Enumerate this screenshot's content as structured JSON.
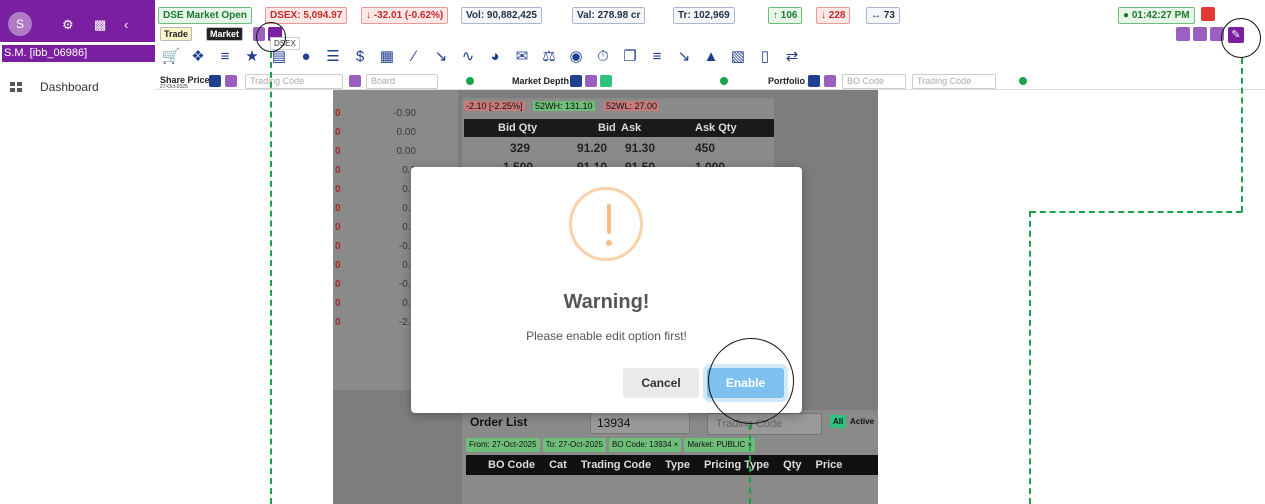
{
  "sidebar": {
    "avatar_letter": "S",
    "user": "S.M. [ibb_06986]",
    "dashboard": "Dashboard"
  },
  "header": {
    "market_status": "DSE Market Open",
    "dsex": "DSEX: 5,094.97",
    "dsex_change": "↓ -32.01 (-0.62%)",
    "vol": "Vol: 90,882,425",
    "val": "Val: 278.98 cr",
    "trades": "Tr: 102,969",
    "up": "↑ 106",
    "down": "↓ 228",
    "unch": "↔ 73",
    "time": "● 01:42:27 PM",
    "trade_btn": "Trade",
    "market_btn": "Market",
    "tooltip": "DSEX"
  },
  "filters": {
    "share_price": "Share Price",
    "date": "27-Oct-2025",
    "trading_code": "Trading Code",
    "board": "Board",
    "market_depth": "Market Depth",
    "portfolio": "Portfolio",
    "bo_code": "BO Code",
    "trading_code2": "Trading Code"
  },
  "list": [
    {
      "a": "0",
      "b": "-0.90"
    },
    {
      "a": "0",
      "b": "0.00"
    },
    {
      "a": "0",
      "b": "0.00"
    },
    {
      "a": "0",
      "b": "0.1"
    },
    {
      "a": "0",
      "b": "0.0"
    },
    {
      "a": "0",
      "b": "0.0"
    },
    {
      "a": "0",
      "b": "0.0"
    },
    {
      "a": "0",
      "b": "-0.4"
    },
    {
      "a": "0",
      "b": "0.0"
    },
    {
      "a": "0",
      "b": "-0.4"
    },
    {
      "a": "0",
      "b": "0.0"
    },
    {
      "a": "0",
      "b": "-2.1"
    }
  ],
  "depth": {
    "change": "-2.10 [-2.25%]",
    "wh": "52WH: 131.10",
    "wl": "52WL: 27.00",
    "head": [
      "Bid Qty",
      "Bid",
      "Ask",
      "Ask Qty"
    ],
    "rows": [
      [
        "329",
        "91.20",
        "91.30",
        "450"
      ],
      [
        "1,500",
        "91.10",
        "91.50",
        "1,000"
      ]
    ]
  },
  "modal": {
    "title": "Warning!",
    "message": "Please enable edit option first!",
    "cancel": "Cancel",
    "enable": "Enable"
  },
  "order": {
    "title": "Order List",
    "code": "13934",
    "trading_code": "Trading Code",
    "all": "All",
    "active": "Active",
    "tags": [
      "From: 27-Oct-2025",
      "To: 27-Oct-2025",
      "BO Code: 13934 ×",
      "Market: PUBLIC ×"
    ],
    "cols": [
      "BO Code",
      "Cat",
      "Trading Code",
      "Type",
      "Pricing Type",
      "Qty",
      "Price"
    ]
  }
}
